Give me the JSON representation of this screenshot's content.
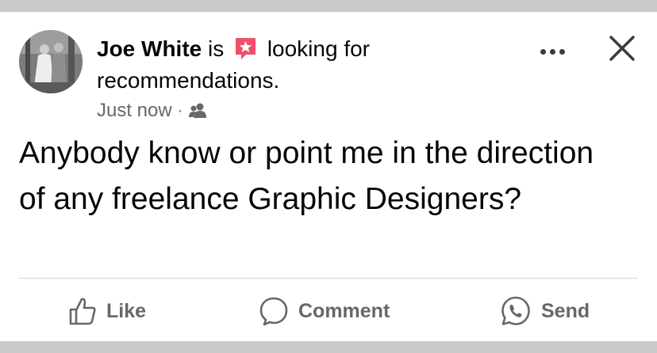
{
  "post": {
    "author_name": "Joe White",
    "status_prefix": "is",
    "status_text": "looking for recommendations.",
    "timestamp": "Just now",
    "separator": "·",
    "audience_icon": "friends-icon",
    "body": "Anybody know or point me in the direction of any freelance Graphic Designers?"
  },
  "actions": {
    "like_label": "Like",
    "comment_label": "Comment",
    "send_label": "Send"
  },
  "colors": {
    "badge": "#f0506e",
    "secondary_text": "#65676b",
    "primary_text": "#050505"
  }
}
